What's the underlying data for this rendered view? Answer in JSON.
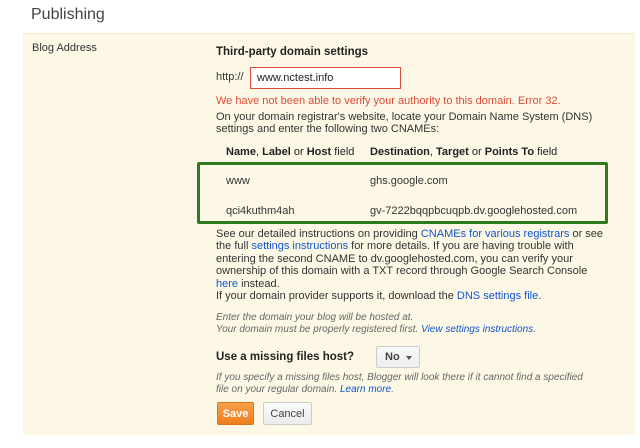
{
  "page": {
    "heading": "Publishing"
  },
  "blog_address": {
    "row_label": "Blog Address",
    "section_title": "Third-party domain settings",
    "http_prefix": "http://",
    "domain_value": "www.nctest.info",
    "error": "We have not been able to verify your authority to this domain. Error 32.",
    "instructions": "On your domain registrar's website, locate your Domain Name System (DNS) settings and enter the following two CNAMEs:"
  },
  "cname_table": {
    "header_name_parts": [
      "Name",
      ", ",
      "Label",
      " or ",
      "Host",
      " field"
    ],
    "header_dest_parts": [
      "Destination",
      ", ",
      "Target",
      " or ",
      "Points To",
      " field"
    ],
    "rows": [
      {
        "name": "www",
        "destination": "ghs.google.com"
      },
      {
        "name": "qci4kuthm4ah",
        "destination": "gv-7222bqqpbcuqpb.dv.googlehosted.com"
      }
    ]
  },
  "details": {
    "line1_pre": "See our detailed instructions on providing ",
    "link_cnames": "CNAMEs for various registrars",
    "line1_post": " or see",
    "line2_pre": "the full ",
    "link_settings": "settings instructions",
    "line2_post": " for more details. If you are having trouble with",
    "line3": "entering the second CNAME to dv.googlehosted.com, you can verify your",
    "line4": "ownership of this domain with a TXT record through Google Search Console",
    "link_here": "here",
    "line5_post": " instead.",
    "line6_pre": "If your domain provider supports it, download the ",
    "link_dns_file": "DNS settings file",
    "line6_post": "."
  },
  "hint1": {
    "line1": "Enter the domain your blog will be hosted at.",
    "line2_pre": "Your domain must be properly registered first. ",
    "link_view": "View settings instructions",
    "line2_post": "."
  },
  "missing_files": {
    "label": "Use a missing files host?",
    "selected": "No",
    "hint_line1": "If you specify a missing files host, Blogger will look there if it cannot find a specified",
    "hint_line2_pre": "file on your regular domain. ",
    "link_learn": "Learn more",
    "hint_line2_post": "."
  },
  "buttons": {
    "save": "Save",
    "cancel": "Cancel"
  }
}
